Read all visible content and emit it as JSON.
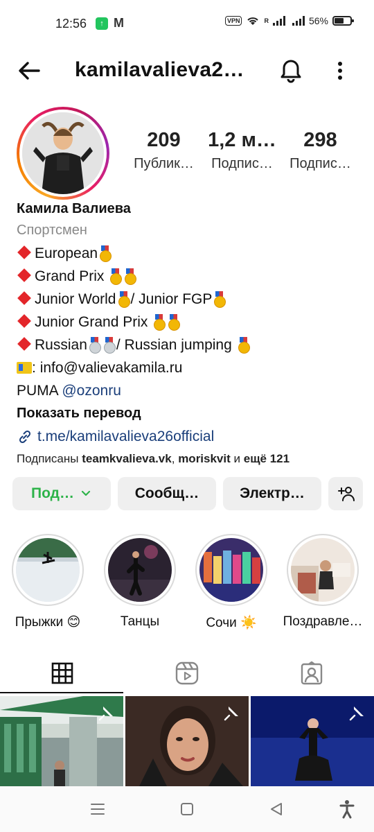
{
  "status_bar": {
    "time": "12:56",
    "app_icon_1": "assistant-app-icon",
    "app_icon_2": "gmail-icon",
    "vpn": "VPN",
    "roaming": "R",
    "battery": "56%"
  },
  "header": {
    "username": "kamilavalieva2…",
    "icons": [
      "back-arrow-icon",
      "bell-icon",
      "more-vertical-icon"
    ]
  },
  "stats": [
    {
      "value": "209",
      "label": "Публик…"
    },
    {
      "value": "1,2 м…",
      "label": "Подпис…"
    },
    {
      "value": "298",
      "label": "Подпис…"
    }
  ],
  "bio": {
    "name": "Камила Валиева",
    "category": "Спортсмен",
    "line1": "European",
    "line2": "Grand Prix",
    "line3a": "Junior World",
    "line3b": "/ Junior FGP",
    "line4": "Junior Grand Prix",
    "line5a": "Russian",
    "line5b": "/ Russian jumping",
    "email_prefix": ":",
    "email": "info@valievakamila.ru",
    "sponsor_text": "PUMA",
    "sponsor_link": "@ozonru",
    "translate": "Показать перевод",
    "website": "t.me/kamilavalieva26official",
    "followed_prefix": "Подписаны",
    "followed_user1": "teamkvalieva.vk",
    "followed_sep": ",",
    "followed_user2": "moriskvit",
    "followed_and": "и",
    "followed_more": "ещё 121"
  },
  "actions": {
    "follow": "Под…",
    "message": "Сообщ…",
    "email": "Электр…"
  },
  "highlights": [
    {
      "label": "Прыжки 😊"
    },
    {
      "label": "Танцы"
    },
    {
      "label": "Сочи ☀️"
    },
    {
      "label": "Поздравле…"
    }
  ],
  "colors": {
    "follow_green": "#2eb34a",
    "link_blue": "#1a3e7a",
    "bio_diamond": "#e3262a",
    "button_bg": "#efefef"
  }
}
